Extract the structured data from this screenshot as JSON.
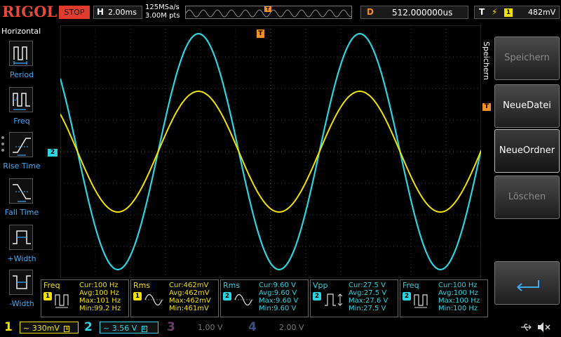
{
  "brand": "RIGOL",
  "run_state": "STOP",
  "horizontal": {
    "letter": "H",
    "timebase": "2.00ms"
  },
  "sampling": {
    "rate": "125MSa/s",
    "points": "3.00M pts"
  },
  "trigger_position_marker": "T",
  "delay": {
    "letter": "D",
    "value": "512.000000us"
  },
  "trigger": {
    "letter": "T",
    "source": "1",
    "level": "482mV"
  },
  "left_menu": {
    "title": "Horizontal",
    "items": [
      {
        "label": "Period",
        "icon": "period-icon"
      },
      {
        "label": "Freq",
        "icon": "frequency-icon"
      },
      {
        "label": "Rise Time",
        "icon": "rise-time-icon"
      },
      {
        "label": "Fall Time",
        "icon": "fall-time-icon"
      },
      {
        "label": "+Width",
        "icon": "positive-width-icon"
      },
      {
        "label": "-Width",
        "icon": "negative-width-icon"
      }
    ]
  },
  "right_menu": {
    "title": "Speichern",
    "keys": [
      {
        "label": "Speichern",
        "state": "disabled"
      },
      {
        "label": "NeueDatei",
        "state": "enabled"
      },
      {
        "label": "NeueOrdner",
        "state": "selected"
      },
      {
        "label": "Löschen",
        "state": "disabled"
      }
    ],
    "enter_icon": "enter-arrow-icon"
  },
  "markers": {
    "ch2_ground": "2",
    "trigger_level": "T",
    "trigger_top": "T"
  },
  "measurements": [
    {
      "name": "Freq",
      "channel": "1",
      "cur": "Cur:100 Hz",
      "avg": "Avg:100 Hz",
      "max": "Max:101 Hz",
      "min": "Min:99.2 Hz",
      "glyph": "freq"
    },
    {
      "name": "Rms",
      "channel": "1",
      "cur": "Cur:462mV",
      "avg": "Avg:462mV",
      "max": "Max:462mV",
      "min": "Min:461mV",
      "glyph": "rms"
    },
    {
      "name": "Rms",
      "channel": "2",
      "cur": "Cur:9.60 V",
      "avg": "Avg:9.60 V",
      "max": "Max:9.60 V",
      "min": "Min:9.60 V",
      "glyph": "rms"
    },
    {
      "name": "Vpp",
      "channel": "2",
      "cur": "Cur:27.5 V",
      "avg": "Avg:27.5 V",
      "max": "Max:27.6 V",
      "min": "Min:27.5 V",
      "glyph": "vpp"
    },
    {
      "name": "Freq",
      "channel": "2",
      "cur": "Cur:100 Hz",
      "avg": "Avg:100 Hz",
      "max": "Max:100 Hz",
      "min": "Min:100 Hz",
      "glyph": "freq"
    }
  ],
  "channels": [
    {
      "num": "1",
      "scale": "330mV",
      "coupling": "~",
      "active": true,
      "color": "#f2e200"
    },
    {
      "num": "2",
      "scale": "3.56 V",
      "coupling": "~",
      "active": true,
      "color": "#2fd3e0"
    },
    {
      "num": "3",
      "scale": "1.00 V",
      "coupling": "",
      "active": false,
      "color": "#c060c0"
    },
    {
      "num": "4",
      "scale": "2.00 V",
      "coupling": "",
      "active": false,
      "color": "#3a6ee8"
    }
  ],
  "status_icons": [
    "usb-icon",
    "speaker-muted-icon"
  ],
  "colors": {
    "ch1": "#f2e200",
    "ch2": "#2fd3e0",
    "stop": "#e03c2e",
    "trigger": "#f29028",
    "menu_label": "#3fa9f5"
  }
}
